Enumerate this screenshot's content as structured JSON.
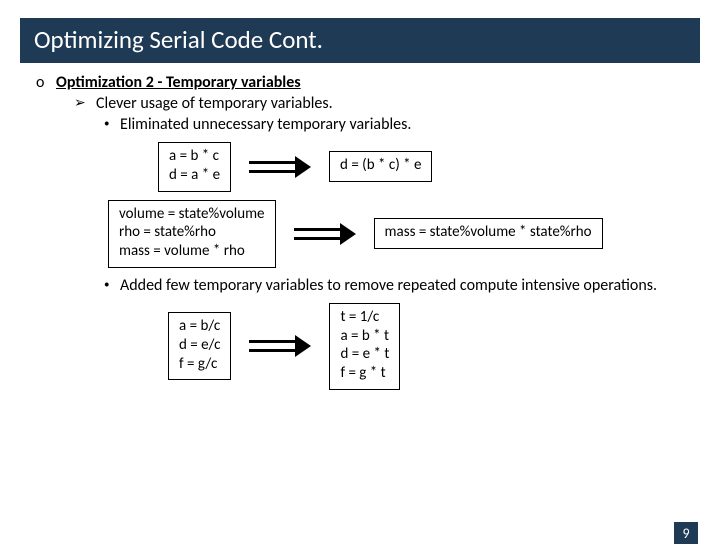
{
  "title": "Optimizing Serial Code Cont.",
  "bullets": {
    "opt2": "Optimization 2  - Temporary variables",
    "clever": "Clever usage of temporary variables.",
    "elim": "Eliminated unnecessary temporary variables.",
    "added": "Added few temporary variables to remove repeated compute intensive operations."
  },
  "markers": {
    "circle": "o",
    "arrowhead": "➢",
    "bullet": "•"
  },
  "examples": {
    "ex1_left": "a = b * c\nd = a * e",
    "ex1_right": "d = (b * c) * e",
    "ex2_left": "volume = state%volume\nrho = state%rho\nmass = volume * rho",
    "ex2_right": "mass = state%volume * state%rho",
    "ex3_left": "a = b/c\nd = e/c\nf = g/c",
    "ex3_right": "t = 1/c\na = b * t\nd = e * t\nf = g * t"
  },
  "page_number": "9"
}
